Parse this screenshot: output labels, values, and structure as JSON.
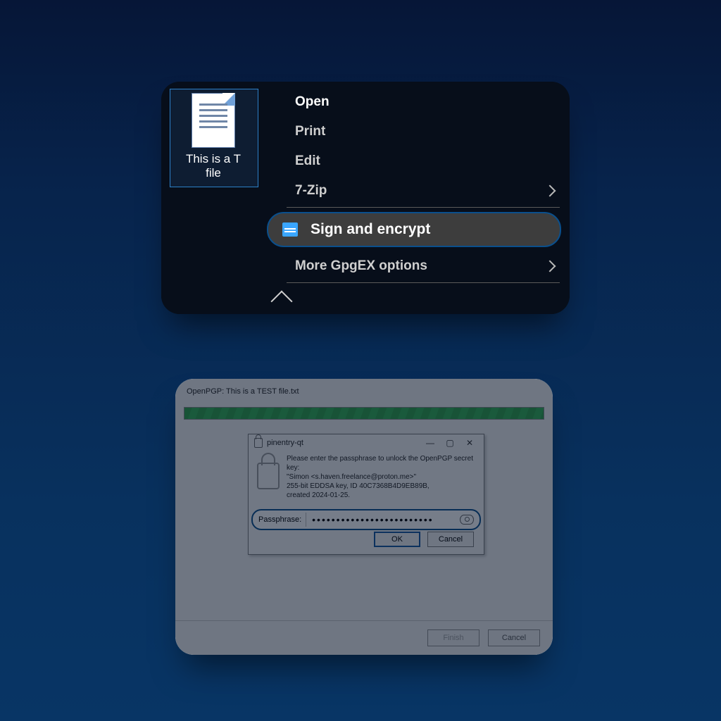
{
  "panel1": {
    "file_name_line1": "This is a T",
    "file_name_line2": "file",
    "menu": {
      "open": "Open",
      "print": "Print",
      "edit": "Edit",
      "sevenzip": "7-Zip",
      "sign_encrypt": "Sign and encrypt",
      "more_gpgex": "More GpgEX options"
    }
  },
  "panel2": {
    "title": "OpenPGP: This is a TEST file.txt",
    "pinentry": {
      "title": "pinentry-qt",
      "line1": "Please enter the passphrase to unlock the OpenPGP secret key:",
      "line2": "\"Simon <s.haven.freelance@proton.me>\"",
      "line3": "255-bit EDDSA key, ID 40C7368B4D9EB89B,",
      "line4": "created 2024-01-25.",
      "pass_label": "Passphrase:",
      "pass_value": "•••••••••••••••••••••••••",
      "ok": "OK",
      "cancel": "Cancel"
    },
    "finish": "Finish",
    "cancel": "Cancel"
  }
}
